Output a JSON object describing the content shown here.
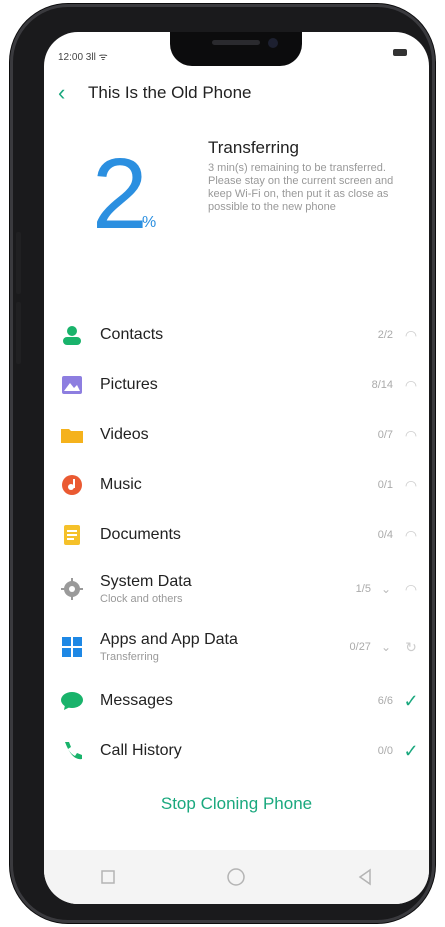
{
  "status": {
    "time": "12:00 3ll ᯤ"
  },
  "header": {
    "back_icon": "chevron-left-icon",
    "title": "This Is the Old Phone"
  },
  "progress": {
    "value": "2",
    "unit": "%",
    "title": "Transferring",
    "message": "3 min(s) remaining to be transferred. Please stay on the current screen and keep Wi-Fi on, then put it as close as possible to the new phone"
  },
  "items": [
    {
      "label": "Contacts",
      "sub": "",
      "count": "2/2",
      "icon": "contacts-icon",
      "state": "pending"
    },
    {
      "label": "Pictures",
      "sub": "",
      "count": "8/14",
      "icon": "pictures-icon",
      "state": "pending"
    },
    {
      "label": "Videos",
      "sub": "",
      "count": "0/7",
      "icon": "videos-icon",
      "state": "pending"
    },
    {
      "label": "Music",
      "sub": "",
      "count": "0/1",
      "icon": "music-icon",
      "state": "pending"
    },
    {
      "label": "Documents",
      "sub": "",
      "count": "0/4",
      "icon": "documents-icon",
      "state": "pending"
    },
    {
      "label": "System Data",
      "sub": "Clock and others",
      "count": "1/5",
      "icon": "system-data-icon",
      "state": "pending"
    },
    {
      "label": "Apps and App Data",
      "sub": "Transferring",
      "count": "0/27",
      "icon": "apps-icon",
      "state": "transferring"
    },
    {
      "label": "Messages",
      "sub": "",
      "count": "6/6",
      "icon": "messages-icon",
      "state": "done"
    },
    {
      "label": "Call History",
      "sub": "",
      "count": "0/0",
      "icon": "call-history-icon",
      "state": "done"
    }
  ],
  "stop_label": "Stop Cloning Phone",
  "colors": {
    "accent": "#1aa87e",
    "progress": "#2b8fe0"
  }
}
